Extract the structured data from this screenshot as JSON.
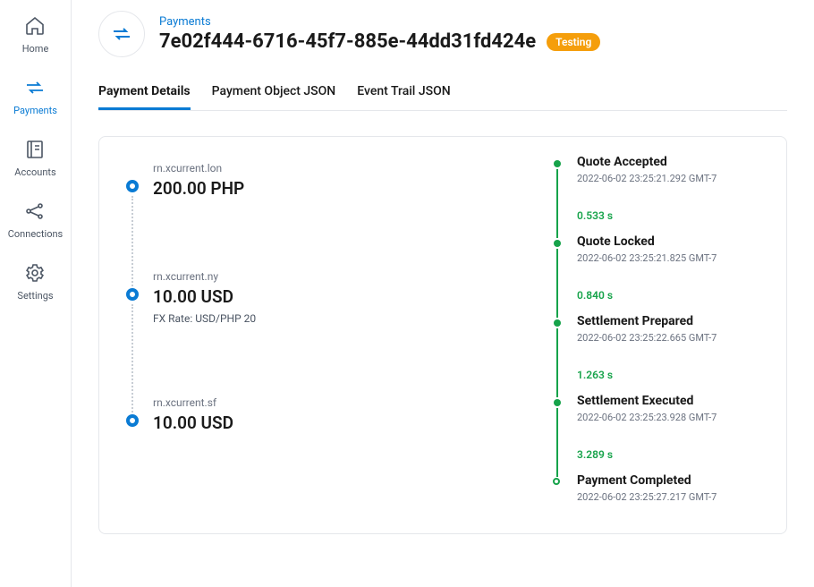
{
  "nav": {
    "items": [
      {
        "label": "Home"
      },
      {
        "label": "Payments"
      },
      {
        "label": "Accounts"
      },
      {
        "label": "Connections"
      },
      {
        "label": "Settings"
      }
    ]
  },
  "header": {
    "breadcrumb": "Payments",
    "title": "7e02f444-6716-45f7-885e-44dd31fd424e",
    "badge": "Testing"
  },
  "tabs": [
    {
      "label": "Payment Details"
    },
    {
      "label": "Payment Object JSON"
    },
    {
      "label": "Event Trail JSON"
    }
  ],
  "chain": {
    "hops": [
      {
        "node": "rn.xcurrent.lon",
        "amount": "200.00 PHP",
        "meta": ""
      },
      {
        "node": "rn.xcurrent.ny",
        "amount": "10.00 USD",
        "meta": "FX Rate: USD/PHP 20"
      },
      {
        "node": "rn.xcurrent.sf",
        "amount": "10.00 USD",
        "meta": ""
      }
    ]
  },
  "timeline": {
    "events": [
      {
        "title": "Quote Accepted",
        "time": "2022-06-02 23:25:21.292 GMT-7",
        "duration_after": "0.533 s"
      },
      {
        "title": "Quote Locked",
        "time": "2022-06-02 23:25:21.825 GMT-7",
        "duration_after": "0.840 s"
      },
      {
        "title": "Settlement Prepared",
        "time": "2022-06-02 23:25:22.665 GMT-7",
        "duration_after": "1.263 s"
      },
      {
        "title": "Settlement Executed",
        "time": "2022-06-02 23:25:23.928 GMT-7",
        "duration_after": "3.289 s"
      },
      {
        "title": "Payment Completed",
        "time": "2022-06-02 23:25:27.217 GMT-7",
        "duration_after": ""
      }
    ]
  }
}
